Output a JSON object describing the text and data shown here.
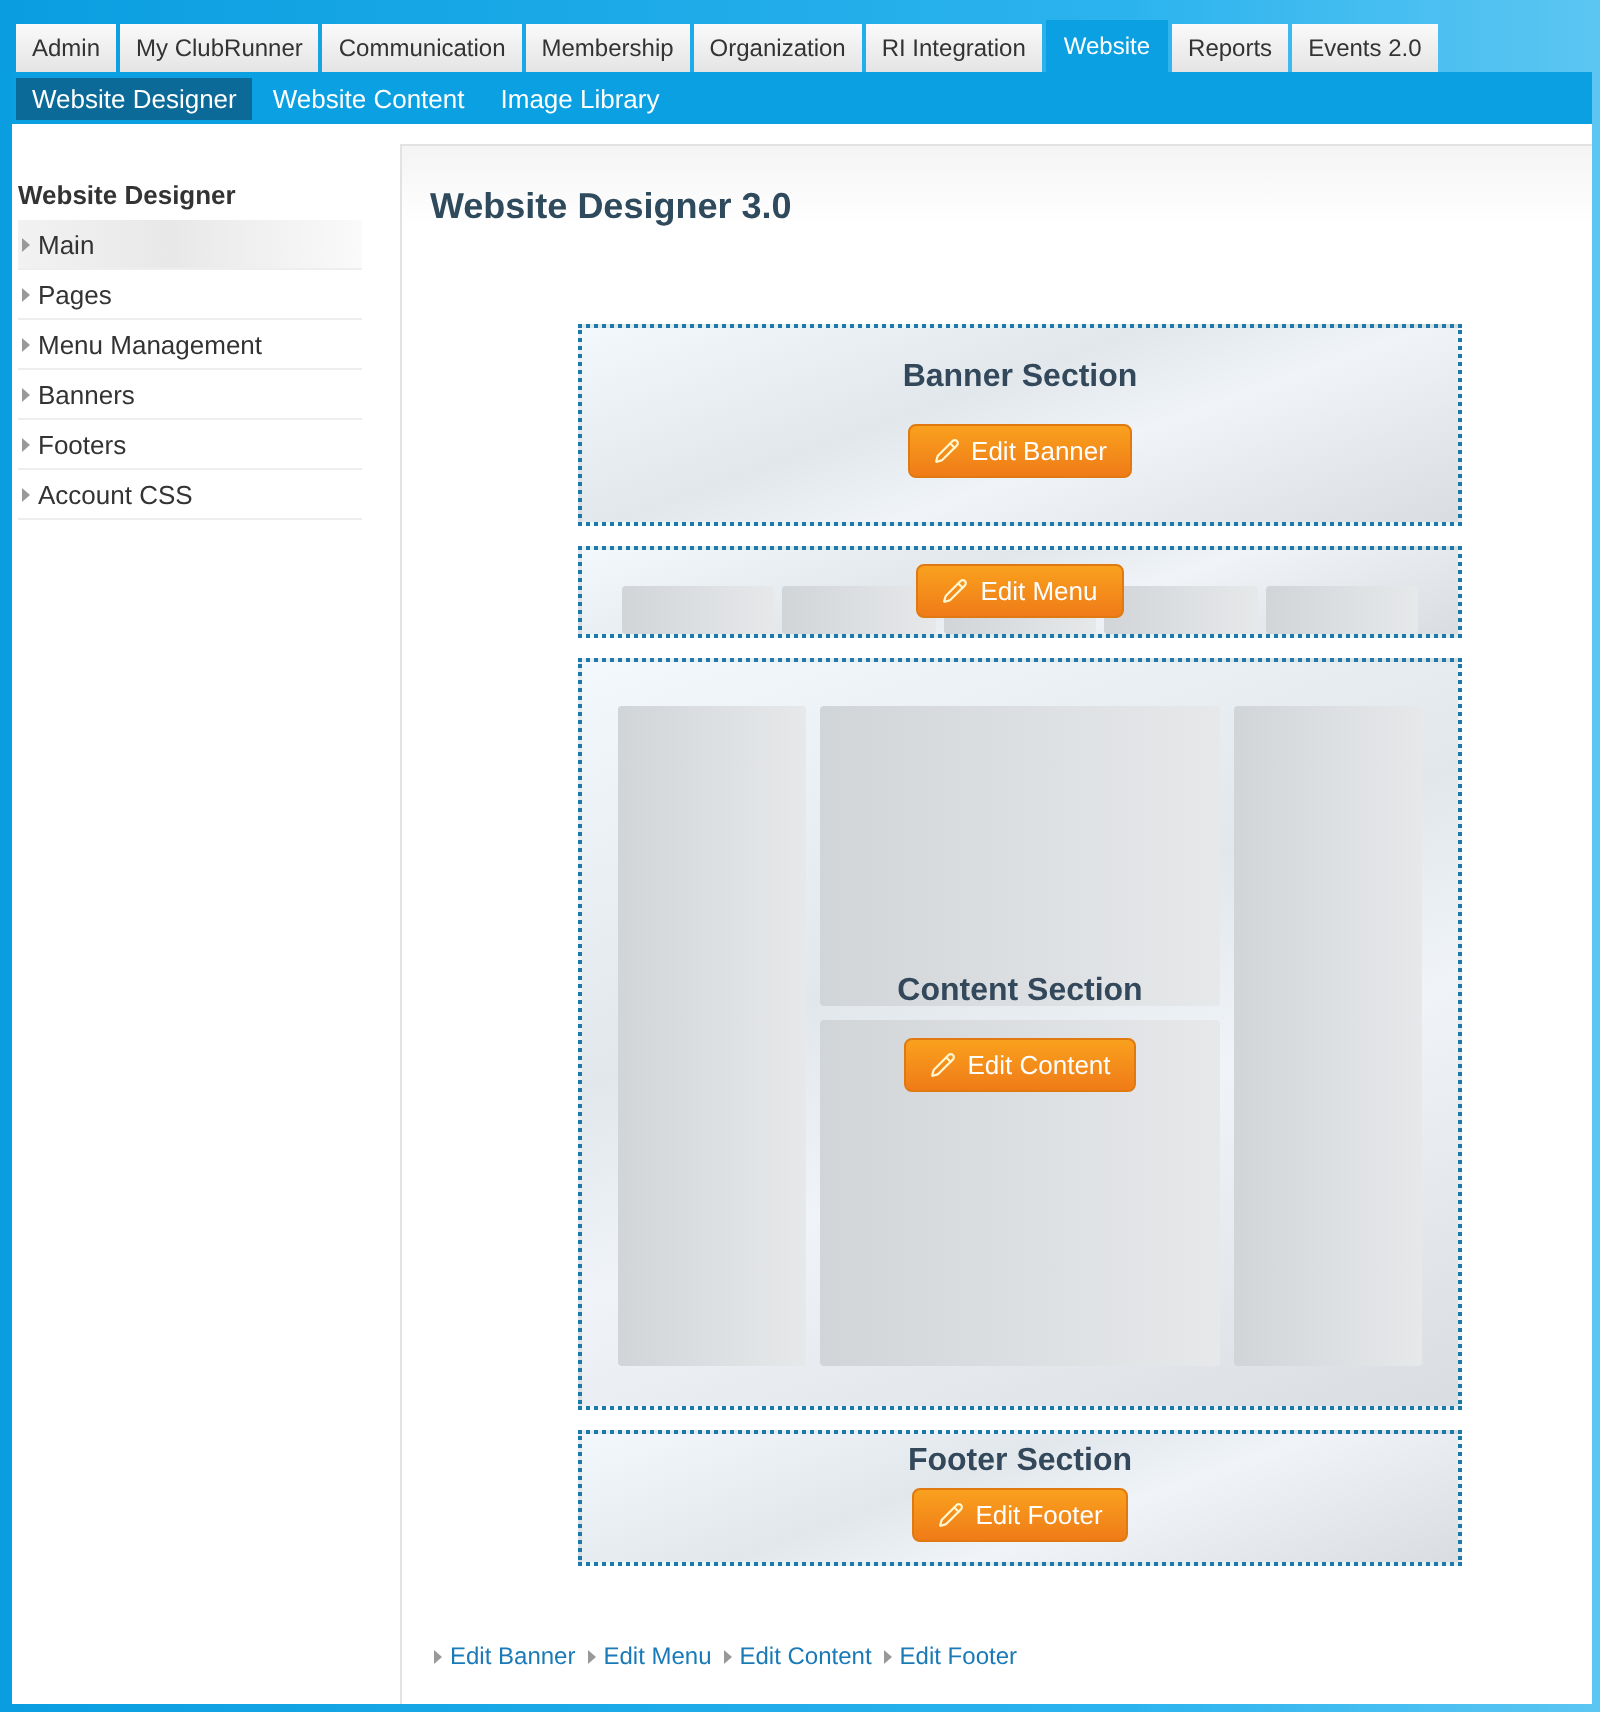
{
  "top_tabs": [
    {
      "label": "Admin",
      "selected": false
    },
    {
      "label": "My ClubRunner",
      "selected": false
    },
    {
      "label": "Communication",
      "selected": false
    },
    {
      "label": "Membership",
      "selected": false
    },
    {
      "label": "Organization",
      "selected": false
    },
    {
      "label": "RI Integration",
      "selected": false
    },
    {
      "label": "Website",
      "selected": true
    },
    {
      "label": "Reports",
      "selected": false
    },
    {
      "label": "Events 2.0",
      "selected": false
    }
  ],
  "sub_tabs": [
    {
      "label": "Website Designer",
      "selected": true
    },
    {
      "label": "Website Content",
      "selected": false
    },
    {
      "label": "Image Library",
      "selected": false
    }
  ],
  "sidebar": {
    "title": "Website Designer",
    "items": [
      {
        "label": "Main",
        "selected": true
      },
      {
        "label": "Pages",
        "selected": false
      },
      {
        "label": "Menu Management",
        "selected": false
      },
      {
        "label": "Banners",
        "selected": false
      },
      {
        "label": "Footers",
        "selected": false
      },
      {
        "label": "Account CSS",
        "selected": false
      }
    ]
  },
  "page_title": "Website Designer 3.0",
  "sections": [
    {
      "kind": "banner",
      "title": "Banner Section",
      "button": "Edit Banner"
    },
    {
      "kind": "menu",
      "button": "Edit Menu"
    },
    {
      "kind": "content",
      "title": "Content Section",
      "button": "Edit Content"
    },
    {
      "kind": "footer",
      "title": "Footer Section",
      "button": "Edit Footer"
    }
  ],
  "links": [
    "Edit Banner",
    "Edit Menu",
    "Edit Content",
    "Edit Footer"
  ]
}
